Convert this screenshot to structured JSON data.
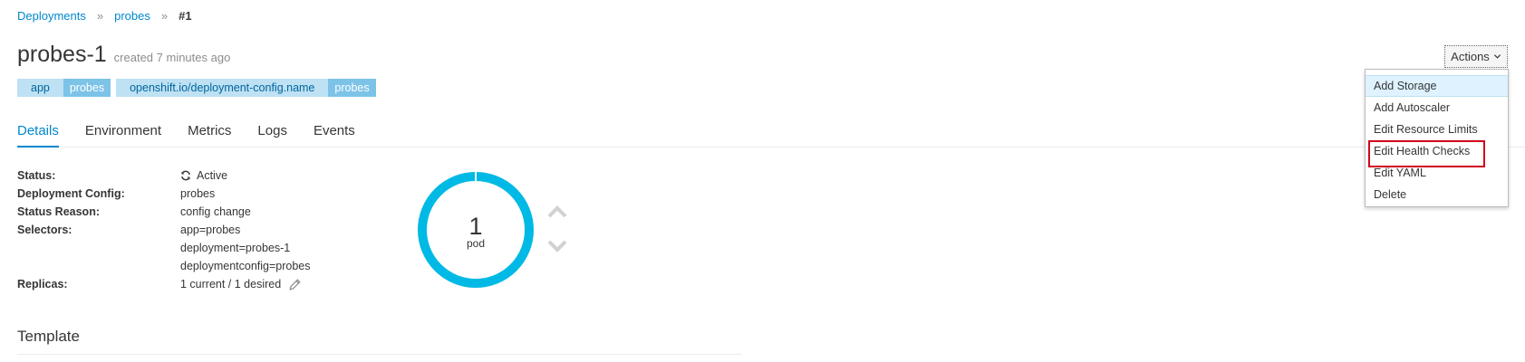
{
  "breadcrumb": {
    "items": [
      "Deployments",
      "probes"
    ],
    "separator": "»",
    "current": "#1"
  },
  "title": "probes-1",
  "created": "created 7 minutes ago",
  "labels": [
    {
      "key": "app",
      "value": "probes"
    },
    {
      "key": "openshift.io/deployment-config.name",
      "value": "probes"
    }
  ],
  "tabs": [
    "Details",
    "Environment",
    "Metrics",
    "Logs",
    "Events"
  ],
  "active_tab": "Details",
  "details": {
    "status_label": "Status:",
    "status_value": "Active",
    "config_label": "Deployment Config:",
    "config_value": "probes",
    "reason_label": "Status Reason:",
    "reason_value": "config change",
    "selectors_label": "Selectors:",
    "selectors": [
      "app=probes",
      "deployment=probes-1",
      "deploymentconfig=probes"
    ],
    "replicas_label": "Replicas:",
    "replicas_value": "1 current / 1 desired"
  },
  "pods": {
    "count": "1",
    "unit": "pod",
    "ring_color": "#00b9e4"
  },
  "template_heading": "Template",
  "actions": {
    "button_label": "Actions",
    "menu": [
      "Add Storage",
      "Add Autoscaler",
      "Edit Resource Limits",
      "Edit Health Checks",
      "Edit YAML",
      "Delete"
    ],
    "hovered": "Add Storage",
    "highlighted": "Edit Health Checks"
  },
  "colors": {
    "link": "#0088ce",
    "highlight_box": "#d0021b"
  },
  "icons": {
    "status": "refresh-icon",
    "edit": "pencil-icon",
    "scale_up": "chevron-up-icon",
    "scale_down": "chevron-down-icon"
  }
}
